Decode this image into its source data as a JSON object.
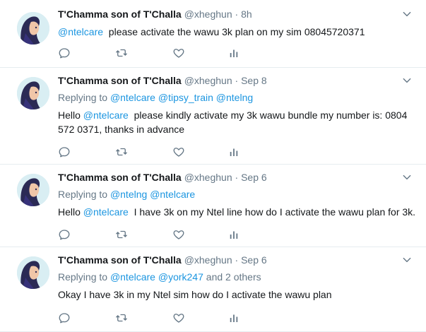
{
  "tweets": [
    {
      "fullname": "T'Chamma son of T'Challa",
      "handle": "@xheghun",
      "separator": "·",
      "time": "8h",
      "reply": null,
      "text_parts": [
        {
          "t": "@ntelcare",
          "mention": true
        },
        {
          "t": "  please activate the wawu 3k plan on my sim 08045720371",
          "mention": false
        }
      ]
    },
    {
      "fullname": "T'Chamma son of T'Challa",
      "handle": "@xheghun",
      "separator": "·",
      "time": "Sep 8",
      "reply": {
        "prefix": "Replying to",
        "parts": [
          {
            "t": "@ntelcare",
            "mention": true
          },
          {
            "t": "@tipsy_train",
            "mention": true
          },
          {
            "t": "@ntelng",
            "mention": true
          }
        ]
      },
      "text_parts": [
        {
          "t": "Hello ",
          "mention": false
        },
        {
          "t": "@ntelcare",
          "mention": true
        },
        {
          "t": "  please kindly activate my 3k wawu bundle my number is: 0804 572 0371, thanks in advance",
          "mention": false
        }
      ]
    },
    {
      "fullname": "T'Chamma son of T'Challa",
      "handle": "@xheghun",
      "separator": "·",
      "time": "Sep 6",
      "reply": {
        "prefix": "Replying to",
        "parts": [
          {
            "t": "@ntelng",
            "mention": true
          },
          {
            "t": "@ntelcare",
            "mention": true
          }
        ]
      },
      "text_parts": [
        {
          "t": "Hello ",
          "mention": false
        },
        {
          "t": "@ntelcare",
          "mention": true
        },
        {
          "t": "  I have 3k on my Ntel line how do I activate the wawu plan for 3k.",
          "mention": false
        }
      ]
    },
    {
      "fullname": "T'Chamma son of T'Challa",
      "handle": "@xheghun",
      "separator": "·",
      "time": "Sep 6",
      "reply": {
        "prefix": "Replying to",
        "parts": [
          {
            "t": "@ntelcare",
            "mention": true
          },
          {
            "t": "@york247",
            "mention": true
          },
          {
            "t": "and 2 others",
            "mention": false
          }
        ]
      },
      "text_parts": [
        {
          "t": "Okay I have 3k in my Ntel sim how do I activate the wawu plan",
          "mention": false
        }
      ]
    }
  ],
  "icons": [
    "reply-icon",
    "retweet-icon",
    "like-icon",
    "analytics-icon",
    "chevron-down-icon"
  ],
  "colors": {
    "mention": "#1b95e0",
    "muted": "#657786",
    "text": "#14171a",
    "divider": "#e6ecf0"
  }
}
